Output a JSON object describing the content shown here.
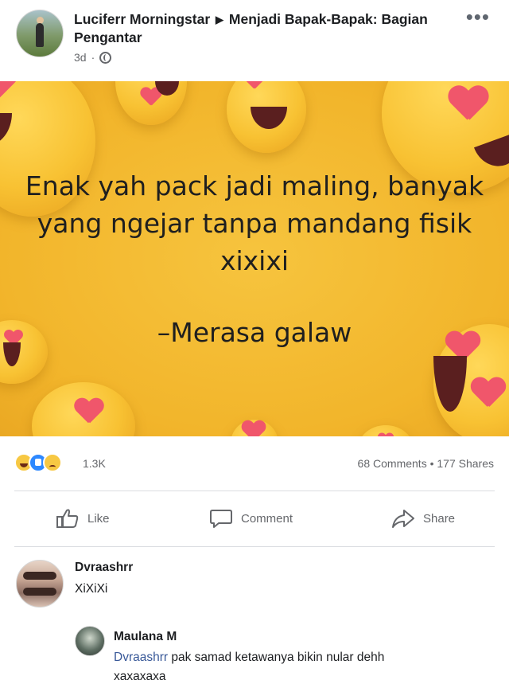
{
  "post": {
    "author": "Luciferr Morningstar",
    "arrow": "▶",
    "group": "Menjadi Bapak-Bapak: Bagian Pengantar",
    "time": "3d",
    "time_sep": "·",
    "privacy_icon": "globe-icon",
    "more_label": "•••"
  },
  "image": {
    "quote": "Enak yah pack jadi maling, banyak yang ngejar tanpa mandang fisik xixixi",
    "signature": "–Merasa galaw",
    "background_color": "#f2b52b"
  },
  "stats": {
    "reactions": [
      "haha-reaction-icon",
      "like-reaction-icon",
      "sad-reaction-icon"
    ],
    "reaction_count": "1.3K",
    "comments": "68 Comments",
    "sep": "•",
    "shares": "177 Shares"
  },
  "actions": {
    "like": "Like",
    "comment": "Comment",
    "share": "Share"
  },
  "comments": [
    {
      "name": "Dvraashrr",
      "text": "XiXiXi"
    },
    {
      "name": "Maulana M",
      "mention": "Dvraashrr",
      "text": " pak samad ketawanya bikin nular dehh",
      "text2": "xaxaxaxa"
    }
  ],
  "colors": {
    "accent": "#385898",
    "muted": "#65676b"
  }
}
